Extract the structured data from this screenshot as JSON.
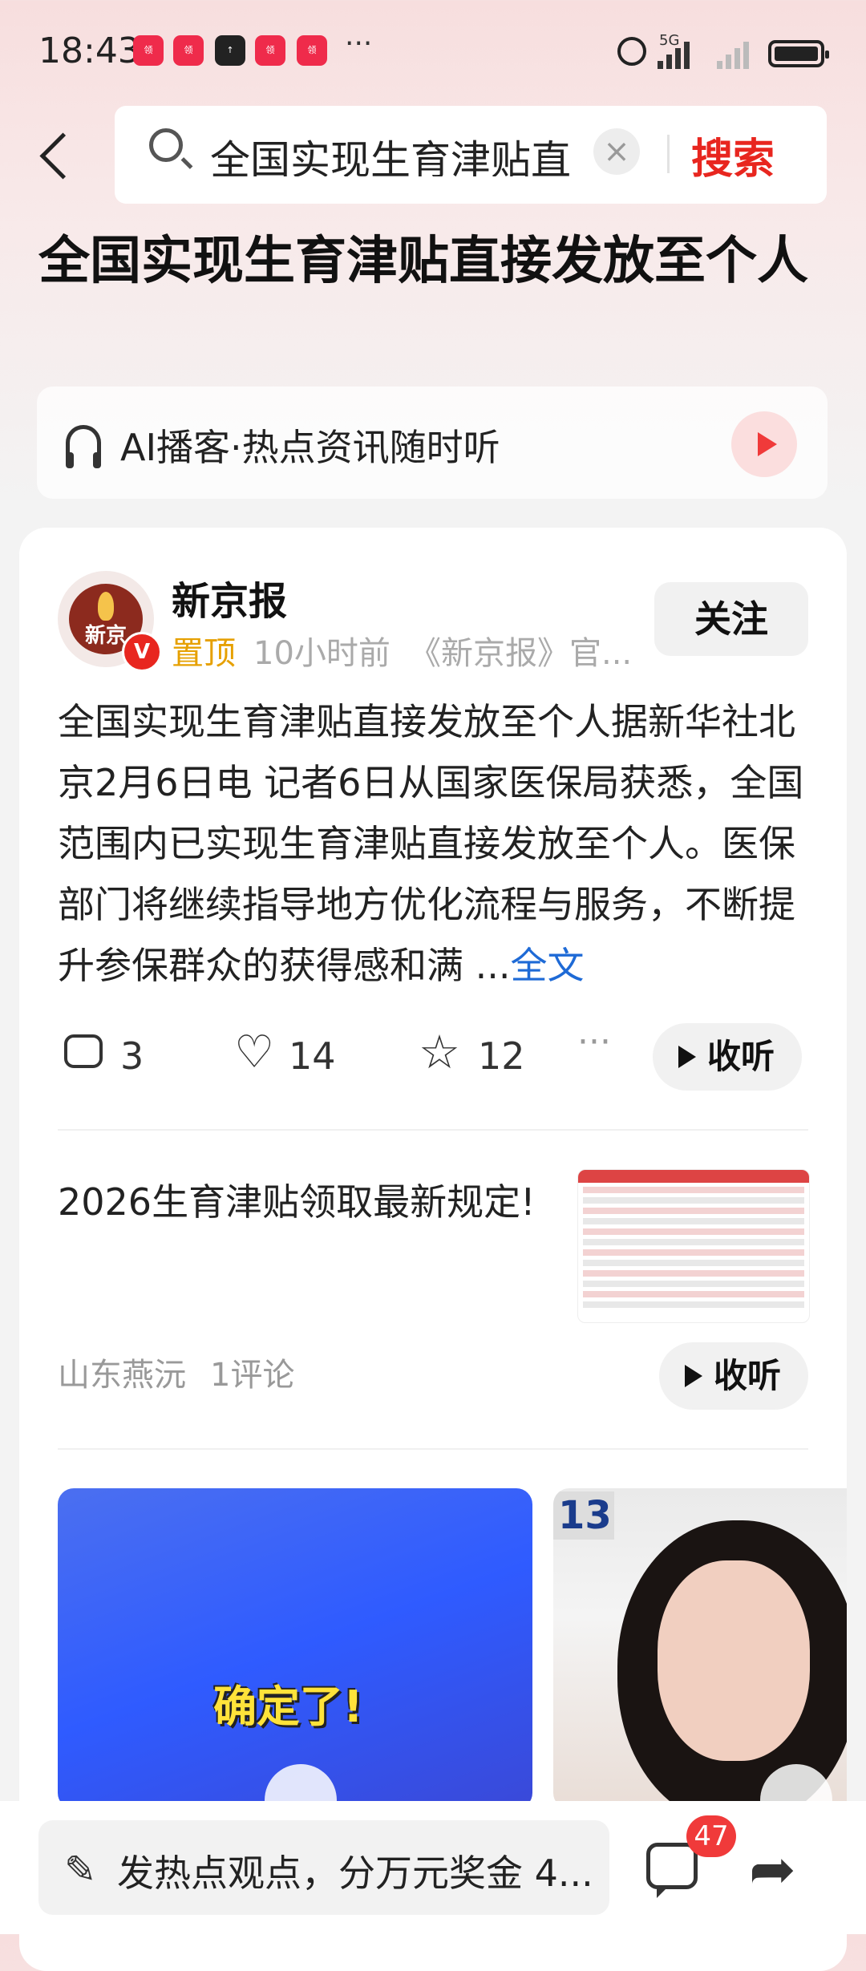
{
  "status_bar": {
    "time": "18:43",
    "app_icons": [
      "app-icon-1",
      "app-icon-2",
      "upload-icon",
      "app-icon-3",
      "app-icon-4"
    ],
    "overflow": "···",
    "network": "5G"
  },
  "search": {
    "query": "全国实现生育津贴直",
    "button_label": "搜索",
    "clear_symbol": "×"
  },
  "page": {
    "title": "全国实现生育津贴直接发放至个人"
  },
  "ai_podcast": {
    "label": "AI播客·热点资讯随时听"
  },
  "post": {
    "author": "新京报",
    "avatar_text": "新京",
    "verified_mark": "V",
    "pinned": "置顶",
    "time": "10小时前",
    "source": "《新京报》官...",
    "follow_label": "关注",
    "text": "全国实现生育津贴直接发放至个人据新华社北京2月6日电 记者6日从国家医保局获悉，全国范围内已实现生育津贴直接发放至个人。医保部门将继续指导地方优化流程与服务，不断提升参保群众的获得感和满 ...",
    "more_label": "全文",
    "comments": "3",
    "likes": "14",
    "favorites": "12",
    "more_symbol": "···",
    "listen_label": "收听"
  },
  "related": {
    "title": "2026生育津贴领取最新规定!",
    "author": "山东燕沅",
    "comments": "1评论",
    "listen_label": "收听"
  },
  "videos": [
    {
      "caption": "确定了!"
    },
    {
      "badge": "13"
    }
  ],
  "bottom_bar": {
    "comment_placeholder": "发热点观点，分万元奖金 4...",
    "comment_count": "47"
  },
  "colors": {
    "accent_red": "#e8261f",
    "link_blue": "#1e6ad6",
    "pinned_orange": "#e6a000"
  }
}
